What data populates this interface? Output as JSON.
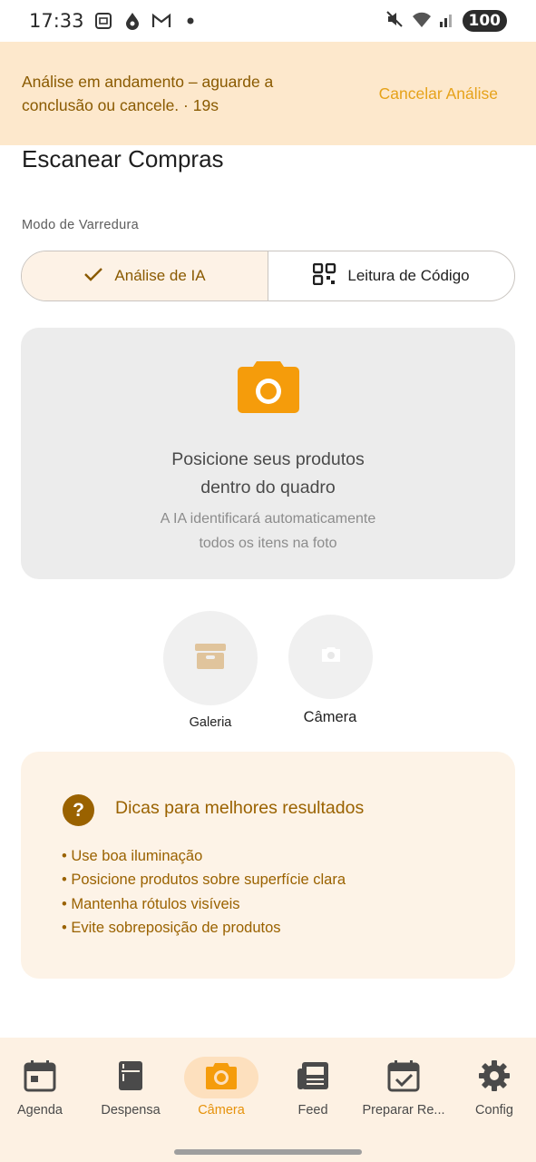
{
  "status_bar": {
    "time": "17:33",
    "battery": "100",
    "left_icons": [
      "screenshot-icon",
      "drop-icon",
      "gmail-icon",
      "dot-icon"
    ],
    "right_icons": [
      "mute-icon",
      "wifi-icon",
      "signal-icon",
      "battery-icon"
    ]
  },
  "banner": {
    "message": "Análise em andamento – aguarde a conclusão ou cancele. · 19s",
    "cancel_label": "Cancelar Análise"
  },
  "page": {
    "title": "Escanear Compras",
    "mode_label": "Modo de Varredura"
  },
  "scan_mode": {
    "options": [
      {
        "label": "Análise de IA",
        "selected": true,
        "icon": "check-icon"
      },
      {
        "label": "Leitura de Código",
        "selected": false,
        "icon": "qr-code-icon"
      }
    ]
  },
  "preview": {
    "icon": "camera-icon",
    "title_line1": "Posicione seus produtos",
    "title_line2": "dentro do quadro",
    "subtitle_line1": "A IA identificará automaticamente",
    "subtitle_line2": "todos os itens na foto"
  },
  "actions": {
    "gallery_label": "Galeria",
    "camera_label": "Câmera"
  },
  "tips": {
    "title": "Dicas para melhores resultados",
    "items": [
      "• Use boa iluminação",
      "• Posicione produtos sobre superfície clara",
      "• Mantenha rótulos visíveis",
      "• Evite sobreposição de produtos"
    ]
  },
  "bottom_nav": {
    "items": [
      {
        "label": "Agenda",
        "icon": "calendar-icon",
        "active": false
      },
      {
        "label": "Despensa",
        "icon": "fridge-icon",
        "active": false
      },
      {
        "label": "Câmera",
        "icon": "camera-icon",
        "active": true
      },
      {
        "label": "Feed",
        "icon": "newspaper-icon",
        "active": false
      },
      {
        "label": "Preparar Re...",
        "icon": "calendar-check-icon",
        "active": false
      },
      {
        "label": "Config",
        "icon": "gear-icon",
        "active": false
      }
    ]
  },
  "colors": {
    "banner_bg": "#fde8cc",
    "accent": "#f59c0b",
    "tips_text": "#9a6200",
    "nav_bg": "#fdf1e3"
  }
}
